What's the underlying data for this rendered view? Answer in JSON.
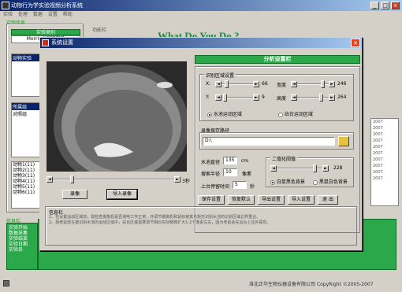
{
  "main_window": {
    "title": "动物行为学实验视频分析系统",
    "menu": [
      "实验",
      "处理",
      "数据",
      "设置",
      "帮助"
    ],
    "left": {
      "exp_info_label": "实验信息",
      "exp_type_label": "实验类别",
      "exp_type_value": "Morris水迷宫实验",
      "list1_item": "动物实验",
      "group_label": "所属组",
      "group_value": "对照组",
      "animals": [
        "动物1(11)",
        "动物2(11)",
        "动物3(11)",
        "动物4(11)",
        "动物5(11)",
        "动物6(11)"
      ],
      "info_label": "信息栏",
      "info_lines": [
        "实验开始",
        "数据采集",
        "实验结束",
        "实验日期",
        "实验员"
      ]
    },
    "function_label": "功能栏",
    "banner_text": "What Do You Do ?",
    "right_list": [
      "2007",
      "2007",
      "2007",
      "2007",
      "2007",
      "2007",
      "2007",
      "2007",
      "2007",
      "2007"
    ],
    "footer": {
      "company": "淮北正华生物仪器设备有限公司",
      "copyright": "CopyRight ©2005-2007"
    }
  },
  "dialog": {
    "title": "系统设置",
    "panel_title": "分析设置栏",
    "region_group": "识别区域设置",
    "x_label": "X:",
    "x_value": "66",
    "width_label": "宽度",
    "width_value": "246",
    "y_label": "Y:",
    "y_value": "9",
    "height_label": "高度",
    "height_value": "264",
    "radio_pool": "水池运动区域",
    "radio_platform": "站台运动区域",
    "path_group": "录像保存路径",
    "path_value": "D:\\",
    "pool_diameter_label": "水池直径",
    "pool_diameter_value": "135",
    "pool_diameter_unit": "cm",
    "search_radius_label": "搜索半径",
    "search_radius_value": "10",
    "search_radius_unit": "像素",
    "platform_time_label": "上台停留时间",
    "platform_time_value": "5",
    "platform_time_unit": "秒",
    "binarize_group": "二值化阈值",
    "binarize_value": "228",
    "radio_white_bg": "白鼠黑色背景",
    "radio_black_bg": "黑鼠白色背景",
    "video_slider_label": "3秒",
    "btn_record": "录像",
    "btn_import": "导入录像",
    "btn_save": "保存设置",
    "btn_restore": "恢复默认",
    "btn_export": "导出设置",
    "btn_load": "导入设置",
    "btn_exit": "退 出",
    "info_title": "信息栏",
    "info_line1": "1、在设置运动区域前，需检查摄像机是否通电工作正常，并调节摄像机和鼠标使其与矩形识别水池的识别区域边界重合。",
    "info_line2": "2、把老鼠放在被识别水池的运动区域中，站台区域需要调节相比实际略微扩大1-2个像素左右，因为老鼠会在站台上往外探究。"
  }
}
